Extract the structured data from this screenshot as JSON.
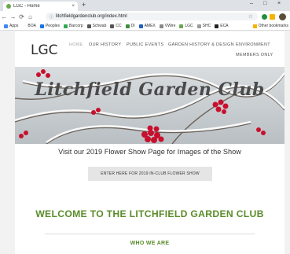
{
  "browser": {
    "tab_title": "LGC - Home",
    "tab_close": "×",
    "new_tab": "+",
    "window_controls": [
      "–",
      "□",
      "×"
    ],
    "url": "litchfieldgardenclub.org/index.html",
    "nav": {
      "back": "←",
      "forward": "→",
      "reload": "⟳",
      "home": "⌂"
    },
    "bookmarks": [
      {
        "label": "Apps",
        "color": "#4285f4"
      },
      {
        "label": "BOA",
        "color": "#ffffff"
      },
      {
        "label": "Peoples",
        "color": "#1a73e8"
      },
      {
        "label": "Barcorp",
        "color": "#34a853"
      },
      {
        "label": "Schwab",
        "color": "#555555"
      },
      {
        "label": "CC",
        "color": "#555555"
      },
      {
        "label": "DI",
        "color": "#3c8d3c"
      },
      {
        "label": "AMEX",
        "color": "#1f5fbf"
      },
      {
        "label": "VWire",
        "color": "#888888"
      },
      {
        "label": "LGC",
        "color": "#6aa84f"
      },
      {
        "label": "SHC",
        "color": "#999999"
      },
      {
        "label": "ECA",
        "color": "#222222"
      }
    ],
    "other_bookmarks": "Other bookmarks"
  },
  "site": {
    "logo": "LGC",
    "nav": {
      "home": "HOME",
      "history": "OUR HISTORY",
      "events": "PUBLIC EVENTS",
      "garden_history": "GARDEN HISTORY & DESIGN",
      "environment": "ENVIRONMENT",
      "members": "MEMBERS ONLY"
    },
    "hero_title": "Litchfield Garden Club",
    "headline": "Visit our 2019 Flower Show Page for Images of the Show",
    "cta": "ENTER HERE FOR 2019 IN-CLUB FLOWER SHOW",
    "welcome": "WELCOME TO THE LITCHFIELD GARDEN CLUB",
    "who_we_are": "WHO WE ARE"
  },
  "colors": {
    "accent_green": "#5b8c2a",
    "berry_red": "#c8102e"
  }
}
